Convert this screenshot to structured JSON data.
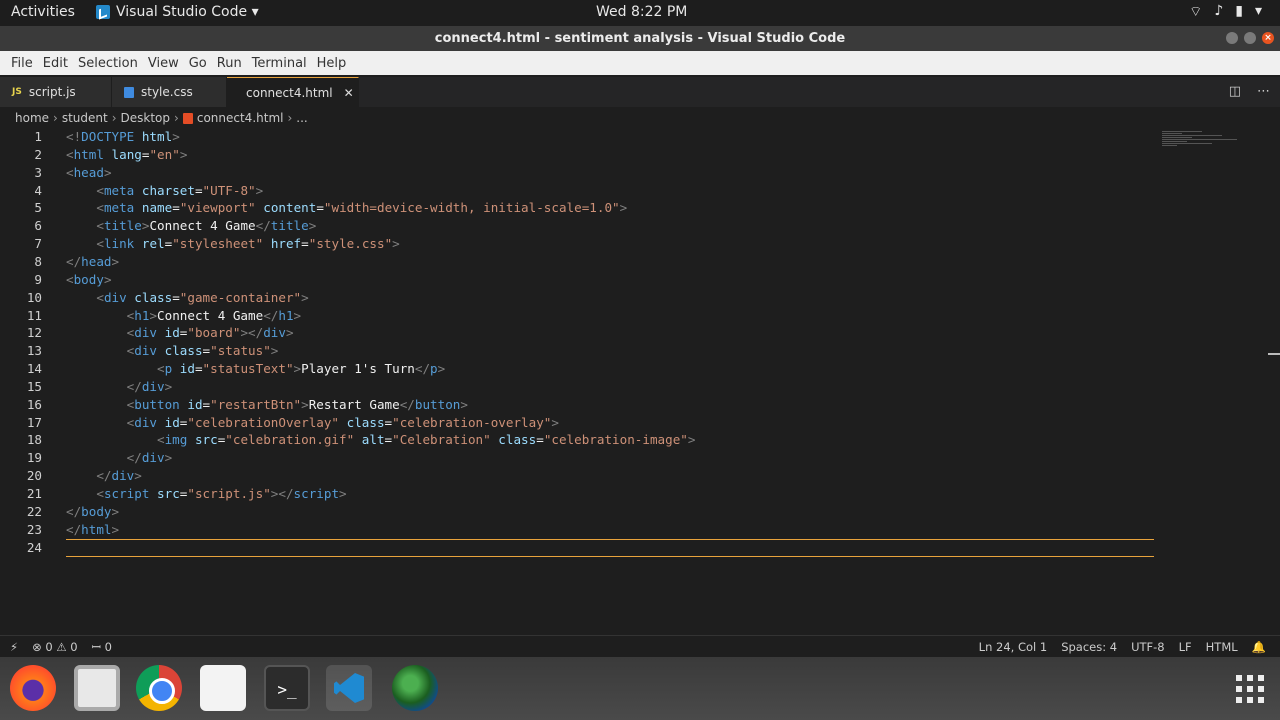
{
  "topbar": {
    "activities": "Activities",
    "app_name": "Visual Studio Code ▾",
    "clock": "Wed  8:22 PM",
    "tray": [
      "wifi-icon",
      "volume-icon",
      "battery-icon",
      "dropdown-icon"
    ]
  },
  "window": {
    "title": "connect4.html - sentiment analysis - Visual Studio Code"
  },
  "menu": [
    "File",
    "Edit",
    "Selection",
    "View",
    "Go",
    "Run",
    "Terminal",
    "Help"
  ],
  "tabs": [
    {
      "label": "script.js",
      "icon": "js-file-icon",
      "badge": "JS"
    },
    {
      "label": "style.css",
      "icon": "css-file-icon"
    },
    {
      "label": "connect4.html",
      "icon": "html-file-icon",
      "active": true,
      "close": "✕"
    }
  ],
  "breadcrumb": [
    "home",
    "student",
    "Desktop",
    "connect4.html",
    "..."
  ],
  "code": [
    {
      "n": "1"
    },
    {
      "n": "2"
    },
    {
      "n": "3"
    },
    {
      "n": "4"
    },
    {
      "n": "5"
    },
    {
      "n": "6"
    },
    {
      "n": "7"
    },
    {
      "n": "8"
    },
    {
      "n": "9"
    },
    {
      "n": "10"
    },
    {
      "n": "11"
    },
    {
      "n": "12"
    },
    {
      "n": "13"
    },
    {
      "n": "14"
    },
    {
      "n": "15"
    },
    {
      "n": "16"
    },
    {
      "n": "17"
    },
    {
      "n": "18"
    },
    {
      "n": "19"
    },
    {
      "n": "20"
    },
    {
      "n": "21"
    },
    {
      "n": "22"
    },
    {
      "n": "23"
    },
    {
      "n": "24"
    }
  ],
  "lines": [
    [
      [
        "pun",
        "<!"
      ],
      [
        "tag",
        "DOCTYPE"
      ],
      [
        "txt",
        " "
      ],
      [
        "attr",
        "html"
      ],
      [
        "pun",
        ">"
      ]
    ],
    [
      [
        "pun",
        "<"
      ],
      [
        "tag",
        "html"
      ],
      [
        "txt",
        " "
      ],
      [
        "attr",
        "lang"
      ],
      [
        "txt",
        "="
      ],
      [
        "str",
        "\"en\""
      ],
      [
        "pun",
        ">"
      ]
    ],
    [
      [
        "pun",
        "<"
      ],
      [
        "tag",
        "head"
      ],
      [
        "pun",
        ">"
      ]
    ],
    [
      [
        "txt",
        "    "
      ],
      [
        "pun",
        "<"
      ],
      [
        "tag",
        "meta"
      ],
      [
        "txt",
        " "
      ],
      [
        "attr",
        "charset"
      ],
      [
        "txt",
        "="
      ],
      [
        "str",
        "\"UTF-8\""
      ],
      [
        "pun",
        ">"
      ]
    ],
    [
      [
        "txt",
        "    "
      ],
      [
        "pun",
        "<"
      ],
      [
        "tag",
        "meta"
      ],
      [
        "txt",
        " "
      ],
      [
        "attr",
        "name"
      ],
      [
        "txt",
        "="
      ],
      [
        "str",
        "\"viewport\""
      ],
      [
        "txt",
        " "
      ],
      [
        "attr",
        "content"
      ],
      [
        "txt",
        "="
      ],
      [
        "str",
        "\"width=device-width, initial-scale=1.0\""
      ],
      [
        "pun",
        ">"
      ]
    ],
    [
      [
        "txt",
        "    "
      ],
      [
        "pun",
        "<"
      ],
      [
        "tag",
        "title"
      ],
      [
        "pun",
        ">"
      ],
      [
        "txt",
        "Connect 4 Game"
      ],
      [
        "pun",
        "</"
      ],
      [
        "tag",
        "title"
      ],
      [
        "pun",
        ">"
      ]
    ],
    [
      [
        "txt",
        "    "
      ],
      [
        "pun",
        "<"
      ],
      [
        "tag",
        "link"
      ],
      [
        "txt",
        " "
      ],
      [
        "attr",
        "rel"
      ],
      [
        "txt",
        "="
      ],
      [
        "str",
        "\"stylesheet\""
      ],
      [
        "txt",
        " "
      ],
      [
        "attr",
        "href"
      ],
      [
        "txt",
        "="
      ],
      [
        "str",
        "\"style.css\""
      ],
      [
        "pun",
        ">"
      ]
    ],
    [
      [
        "pun",
        "</"
      ],
      [
        "tag",
        "head"
      ],
      [
        "pun",
        ">"
      ]
    ],
    [
      [
        "pun",
        "<"
      ],
      [
        "tag",
        "body"
      ],
      [
        "pun",
        ">"
      ]
    ],
    [
      [
        "txt",
        "    "
      ],
      [
        "pun",
        "<"
      ],
      [
        "tag",
        "div"
      ],
      [
        "txt",
        " "
      ],
      [
        "attr",
        "class"
      ],
      [
        "txt",
        "="
      ],
      [
        "str",
        "\"game-container\""
      ],
      [
        "pun",
        ">"
      ]
    ],
    [
      [
        "txt",
        "        "
      ],
      [
        "pun",
        "<"
      ],
      [
        "tag",
        "h1"
      ],
      [
        "pun",
        ">"
      ],
      [
        "txt",
        "Connect 4 Game"
      ],
      [
        "pun",
        "</"
      ],
      [
        "tag",
        "h1"
      ],
      [
        "pun",
        ">"
      ]
    ],
    [
      [
        "txt",
        "        "
      ],
      [
        "pun",
        "<"
      ],
      [
        "tag",
        "div"
      ],
      [
        "txt",
        " "
      ],
      [
        "attr",
        "id"
      ],
      [
        "txt",
        "="
      ],
      [
        "str",
        "\"board\""
      ],
      [
        "pun",
        "></"
      ],
      [
        "tag",
        "div"
      ],
      [
        "pun",
        ">"
      ]
    ],
    [
      [
        "txt",
        "        "
      ],
      [
        "pun",
        "<"
      ],
      [
        "tag",
        "div"
      ],
      [
        "txt",
        " "
      ],
      [
        "attr",
        "class"
      ],
      [
        "txt",
        "="
      ],
      [
        "str",
        "\"status\""
      ],
      [
        "pun",
        ">"
      ]
    ],
    [
      [
        "txt",
        "            "
      ],
      [
        "pun",
        "<"
      ],
      [
        "tag",
        "p"
      ],
      [
        "txt",
        " "
      ],
      [
        "attr",
        "id"
      ],
      [
        "txt",
        "="
      ],
      [
        "str",
        "\"statusText\""
      ],
      [
        "pun",
        ">"
      ],
      [
        "txt",
        "Player 1's Turn"
      ],
      [
        "pun",
        "</"
      ],
      [
        "tag",
        "p"
      ],
      [
        "pun",
        ">"
      ]
    ],
    [
      [
        "txt",
        "        "
      ],
      [
        "pun",
        "</"
      ],
      [
        "tag",
        "div"
      ],
      [
        "pun",
        ">"
      ]
    ],
    [
      [
        "txt",
        "        "
      ],
      [
        "pun",
        "<"
      ],
      [
        "tag",
        "button"
      ],
      [
        "txt",
        " "
      ],
      [
        "attr",
        "id"
      ],
      [
        "txt",
        "="
      ],
      [
        "str",
        "\"restartBtn\""
      ],
      [
        "pun",
        ">"
      ],
      [
        "txt",
        "Restart Game"
      ],
      [
        "pun",
        "</"
      ],
      [
        "tag",
        "button"
      ],
      [
        "pun",
        ">"
      ]
    ],
    [
      [
        "txt",
        "        "
      ],
      [
        "pun",
        "<"
      ],
      [
        "tag",
        "div"
      ],
      [
        "txt",
        " "
      ],
      [
        "attr",
        "id"
      ],
      [
        "txt",
        "="
      ],
      [
        "str",
        "\"celebrationOverlay\""
      ],
      [
        "txt",
        " "
      ],
      [
        "attr",
        "class"
      ],
      [
        "txt",
        "="
      ],
      [
        "str",
        "\"celebration-overlay\""
      ],
      [
        "pun",
        ">"
      ]
    ],
    [
      [
        "txt",
        "            "
      ],
      [
        "pun",
        "<"
      ],
      [
        "tag",
        "img"
      ],
      [
        "txt",
        " "
      ],
      [
        "attr",
        "src"
      ],
      [
        "txt",
        "="
      ],
      [
        "str",
        "\"celebration.gif\""
      ],
      [
        "txt",
        " "
      ],
      [
        "attr",
        "alt"
      ],
      [
        "txt",
        "="
      ],
      [
        "str",
        "\"Celebration\""
      ],
      [
        "txt",
        " "
      ],
      [
        "attr",
        "class"
      ],
      [
        "txt",
        "="
      ],
      [
        "str",
        "\"celebration-image\""
      ],
      [
        "pun",
        ">"
      ]
    ],
    [
      [
        "txt",
        "        "
      ],
      [
        "pun",
        "</"
      ],
      [
        "tag",
        "div"
      ],
      [
        "pun",
        ">"
      ]
    ],
    [
      [
        "txt",
        "    "
      ],
      [
        "pun",
        "</"
      ],
      [
        "tag",
        "div"
      ],
      [
        "pun",
        ">"
      ]
    ],
    [
      [
        "txt",
        "    "
      ],
      [
        "pun",
        "<"
      ],
      [
        "tag",
        "script"
      ],
      [
        "txt",
        " "
      ],
      [
        "attr",
        "src"
      ],
      [
        "txt",
        "="
      ],
      [
        "str",
        "\"script.js\""
      ],
      [
        "pun",
        "></"
      ],
      [
        "tag",
        "script"
      ],
      [
        "pun",
        ">"
      ]
    ],
    [
      [
        "pun",
        "</"
      ],
      [
        "tag",
        "body"
      ],
      [
        "pun",
        ">"
      ]
    ],
    [
      [
        "pun",
        "</"
      ],
      [
        "tag",
        "html"
      ],
      [
        "pun",
        ">"
      ]
    ],
    []
  ],
  "status": {
    "errors": "⊗ 0 ⚠ 0",
    "ports": "ꟷ 0",
    "position": "Ln 24, Col 1",
    "spaces": "Spaces: 4",
    "encoding": "UTF-8",
    "eol": "LF",
    "language": "HTML"
  },
  "colors": {
    "accent": "#e8a33c",
    "editor_bg": "#1e1e1e",
    "tag": "#569cd6",
    "attr": "#9cdcfe",
    "string": "#ce9178"
  }
}
